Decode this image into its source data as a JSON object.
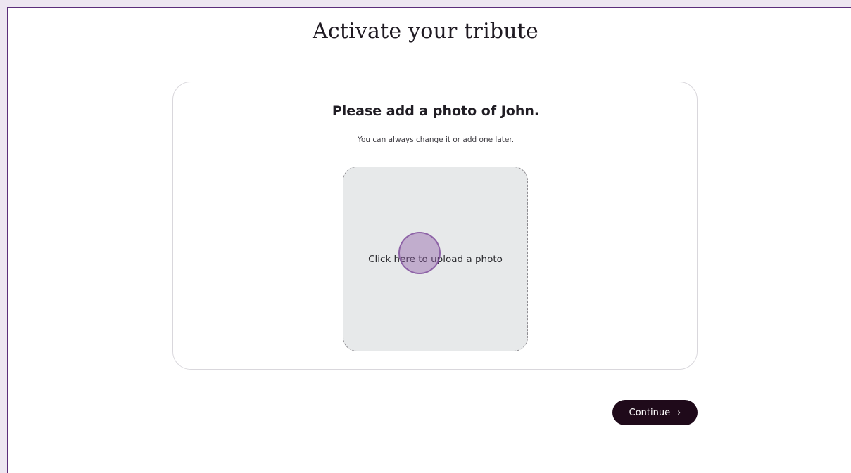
{
  "page": {
    "title": "Activate your tribute"
  },
  "card": {
    "title": "Please add a photo of John.",
    "subtitle": "You can always change it or add one later."
  },
  "upload": {
    "label": "Click here to upload a photo"
  },
  "actions": {
    "continue_label": "Continue",
    "continue_icon": "›"
  },
  "colors": {
    "frame_accent": "#5b2e7a",
    "button_bg": "#1f0a1a",
    "upload_bg": "#e7e9ea",
    "click_indicator": "#8c5aa5"
  }
}
